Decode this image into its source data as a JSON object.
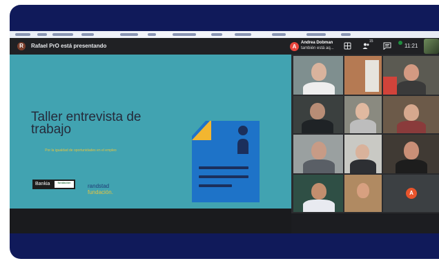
{
  "presenter": {
    "avatar_initial": "R",
    "text": "Rafael PrO está presentando"
  },
  "joiner": {
    "avatar_initial": "A",
    "name": "Andrea Dobman",
    "subtitle": "también está aq..."
  },
  "toolbar": {
    "layout_icon": "grid-icon",
    "people_icon": "people-icon",
    "people_count": "15",
    "chat_icon": "chat-icon",
    "time": "11:21"
  },
  "slide": {
    "title_line1": "Taller entrevista de",
    "title_line2": "trabajo",
    "subtitle": "Por la igualdad de oportunidades en el empleo",
    "bankia_label": "Bankia",
    "bankia_foundation": "fundación",
    "randstad_line1": "randstad",
    "randstad_line2": "fundación."
  },
  "participant_tile": {
    "avatar_initial": "A"
  },
  "colors": {
    "frame": "#101a5a",
    "slide_bg": "#41a3b1",
    "doc_blue": "#1e73c8",
    "doc_yellow": "#f2b630",
    "doc_navy": "#1b2f5c",
    "avatar_orange": "#e8542c"
  }
}
